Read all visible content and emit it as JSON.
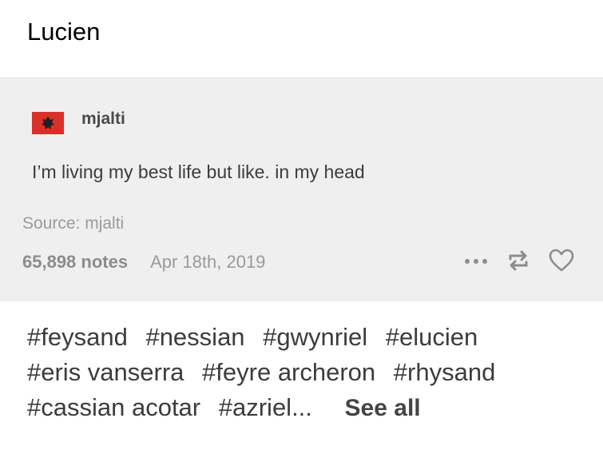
{
  "header": {
    "title": "Lucien"
  },
  "post": {
    "username": "mjalti",
    "avatar_icon": "albania-flag-icon",
    "body": "I’m living my best life but like. in my head",
    "source": "Source: mjalti",
    "notes": "65,898 notes",
    "date": "Apr 18th, 2019",
    "actions": [
      {
        "icon": "more-icon"
      },
      {
        "icon": "reblog-icon"
      },
      {
        "icon": "heart-icon"
      }
    ]
  },
  "tags": {
    "items": [
      "#feysand",
      "#nessian",
      "#gwynriel",
      "#elucien",
      "#eris vanserra",
      "#feyre archeron",
      "#rhysand",
      "#cassian acotar",
      "#azriel..."
    ],
    "see_all_label": "See all"
  },
  "colors": {
    "card_background": "#efefef",
    "flag_red": "#d8312a",
    "text_dark": "#3c3c3c",
    "text_muted": "#9a9a9a"
  }
}
